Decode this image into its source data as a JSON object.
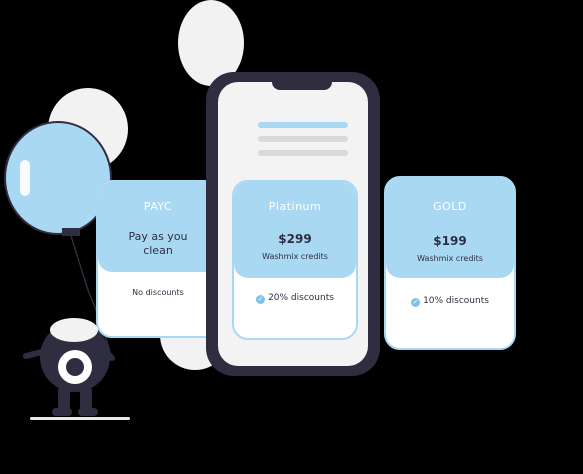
{
  "plans": [
    {
      "name": "PAYC",
      "title_line1": "Pay as you",
      "title_line2": "clean",
      "discount": "No discounts"
    },
    {
      "name": "Platinum",
      "price": "$299",
      "credits": "Washmix credits",
      "discount": "20% discounts"
    },
    {
      "name": "GOLD",
      "price": "$199",
      "credits": "Washmix credits",
      "discount": "10% discounts"
    }
  ],
  "colors": {
    "accent": "#a9d8f3",
    "ink": "#2f2e41",
    "background": "#000000",
    "card": "#ffffff"
  },
  "icons": {
    "check": "check-circle-icon"
  }
}
